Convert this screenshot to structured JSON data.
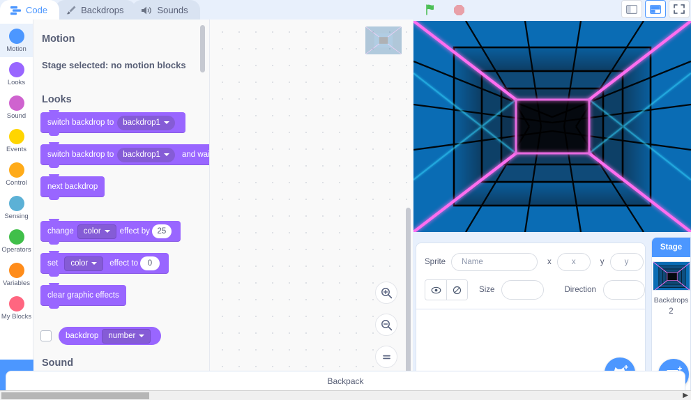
{
  "tabs": [
    {
      "label": "Code",
      "icon": "code-icon",
      "active": true
    },
    {
      "label": "Backdrops",
      "icon": "paintbrush-icon",
      "active": false
    },
    {
      "label": "Sounds",
      "icon": "speaker-icon",
      "active": false
    }
  ],
  "controls": {
    "green_flag": "green-flag-icon",
    "stop": "stop-icon",
    "small_stage": "small-stage-icon",
    "large_stage": "large-stage-icon",
    "fullscreen": "fullscreen-icon"
  },
  "categories": [
    {
      "label": "Motion",
      "color": "#4c97ff",
      "selected": true
    },
    {
      "label": "Looks",
      "color": "#9966ff",
      "selected": false
    },
    {
      "label": "Sound",
      "color": "#cf63cf",
      "selected": false
    },
    {
      "label": "Events",
      "color": "#ffd500",
      "selected": false
    },
    {
      "label": "Control",
      "color": "#ffab19",
      "selected": false
    },
    {
      "label": "Sensing",
      "color": "#5cb1d6",
      "selected": false
    },
    {
      "label": "Operators",
      "color": "#40bf4a",
      "selected": false
    },
    {
      "label": "Variables",
      "color": "#ff8c1a",
      "selected": false
    },
    {
      "label": "My Blocks",
      "color": "#ff6680",
      "selected": false
    }
  ],
  "extension_button": {
    "name": "add-extension-button",
    "icon": "add-extension-icon"
  },
  "palette": {
    "headings": {
      "motion": "Motion",
      "motion_note": "Stage selected: no motion blocks",
      "looks": "Looks",
      "sound": "Sound"
    },
    "blocks": {
      "switch_backdrop": {
        "text": "switch backdrop to",
        "value": "backdrop1"
      },
      "switch_backdrop_wait": {
        "text": "switch backdrop to",
        "value": "backdrop1",
        "suffix": "and wait"
      },
      "next_backdrop": {
        "text": "next backdrop"
      },
      "change_effect": {
        "text": "change",
        "effect": "color",
        "mid": "effect by",
        "value": "25"
      },
      "set_effect": {
        "text": "set",
        "effect": "color",
        "mid": "effect to",
        "value": "0"
      },
      "clear_effects": {
        "text": "clear graphic effects"
      },
      "backdrop_reporter": {
        "text": "backdrop",
        "value": "number",
        "checked": false
      }
    }
  },
  "canvas": {
    "zoom_in": "zoom-in-icon",
    "zoom_out": "zoom-out-icon",
    "zoom_reset": "zoom-reset-icon"
  },
  "sprite_info": {
    "sprite_label": "Sprite",
    "name_placeholder": "Name",
    "x_label": "x",
    "x_placeholder": "x",
    "y_label": "y",
    "y_placeholder": "y",
    "show_icon": "eye-show-icon",
    "hide_icon": "eye-hide-icon",
    "size_label": "Size",
    "size_value": "",
    "direction_label": "Direction",
    "direction_value": "",
    "add_sprite_button": "choose-a-sprite-icon"
  },
  "stage_selector": {
    "title": "Stage",
    "backdrops_label": "Backdrops",
    "count": "2",
    "add_backdrop_button": "choose-a-backdrop-icon"
  },
  "backpack": {
    "label": "Backpack"
  },
  "theme": {
    "looks_purple": "#9966ff",
    "looks_purple_dark": "#855cd6",
    "accent_blue": "#4c97ff",
    "text_gray": "#575e75",
    "panel_bg": "#e8f0fc"
  }
}
